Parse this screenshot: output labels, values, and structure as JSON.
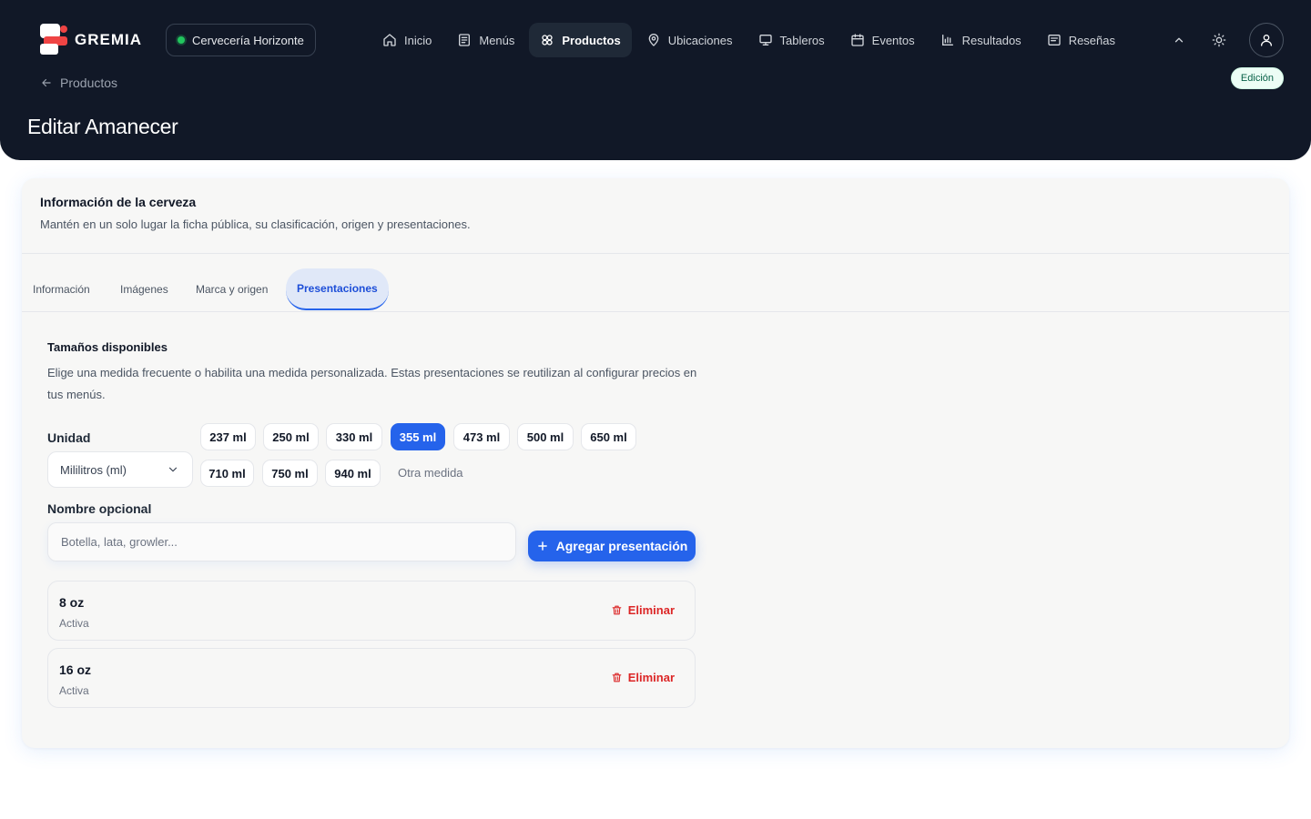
{
  "brand": {
    "name": "GREMIA"
  },
  "org": {
    "name": "Cervecería Horizonte"
  },
  "nav": [
    {
      "label": "Inicio",
      "icon": "home-icon",
      "active": false
    },
    {
      "label": "Menús",
      "icon": "menu-list-icon",
      "active": false
    },
    {
      "label": "Productos",
      "icon": "products-icon",
      "active": true
    },
    {
      "label": "Ubicaciones",
      "icon": "location-pin-icon",
      "active": false
    },
    {
      "label": "Tableros",
      "icon": "monitor-icon",
      "active": false
    },
    {
      "label": "Eventos",
      "icon": "calendar-icon",
      "active": false
    },
    {
      "label": "Resultados",
      "icon": "bar-chart-icon",
      "active": false
    },
    {
      "label": "Reseñas",
      "icon": "review-icon",
      "active": false
    }
  ],
  "mode_badge": "Edición",
  "breadcrumb": {
    "back_label": "Productos"
  },
  "page_title": "Editar Amanecer",
  "card": {
    "title": "Información de la cerveza",
    "subtitle": "Mantén en un solo lugar la ficha pública, su clasificación, origen y presentaciones."
  },
  "tabs": [
    {
      "label": "Información",
      "active": false
    },
    {
      "label": "Imágenes",
      "active": false
    },
    {
      "label": "Marca y origen",
      "active": false
    },
    {
      "label": "Presentaciones",
      "active": true
    }
  ],
  "sizes_section": {
    "title": "Tamaños disponibles",
    "description": "Elige una medida frecuente o habilita una medida personalizada. Estas presentaciones se reutilizan al configurar precios en tus menús."
  },
  "unit": {
    "label": "Unidad",
    "value": "Mililitros (ml)"
  },
  "sizes": [
    {
      "label": "237 ml",
      "selected": false
    },
    {
      "label": "250 ml",
      "selected": false
    },
    {
      "label": "330 ml",
      "selected": false
    },
    {
      "label": "355 ml",
      "selected": true
    },
    {
      "label": "473 ml",
      "selected": false
    },
    {
      "label": "500 ml",
      "selected": false
    },
    {
      "label": "650 ml",
      "selected": false
    },
    {
      "label": "710 ml",
      "selected": false
    },
    {
      "label": "750 ml",
      "selected": false
    },
    {
      "label": "940 ml",
      "selected": false
    }
  ],
  "other_size_label": "Otra medida",
  "optional_name": {
    "label": "Nombre opcional",
    "placeholder": "Botella, lata, growler...",
    "value": ""
  },
  "add_button_label": "Agregar presentación",
  "presentations": [
    {
      "name": "8 oz",
      "status": "Activa",
      "delete_label": "Eliminar"
    },
    {
      "name": "16 oz",
      "status": "Activa",
      "delete_label": "Eliminar"
    }
  ],
  "colors": {
    "accent": "#2563eb",
    "topbar": "#111827",
    "danger": "#dc2626",
    "status_dot": "#22c55e"
  }
}
